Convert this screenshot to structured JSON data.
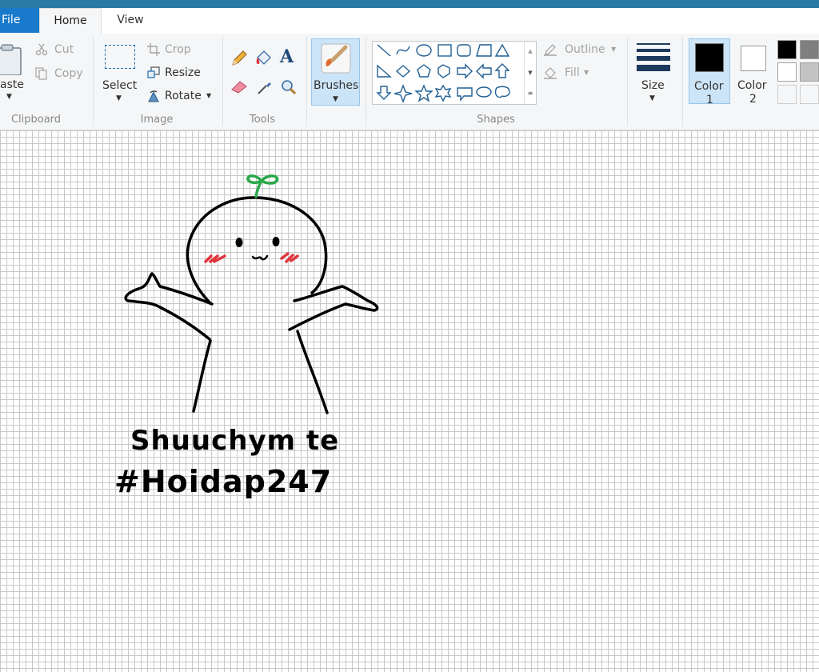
{
  "tabs": {
    "file": "File",
    "home": "Home",
    "view": "View"
  },
  "clipboard": {
    "paste": "aste",
    "cut": "Cut",
    "copy": "Copy",
    "label": "Clipboard"
  },
  "image": {
    "select": "Select",
    "crop": "Crop",
    "resize": "Resize",
    "rotate": "Rotate",
    "label": "Image"
  },
  "tools": {
    "label": "Tools"
  },
  "brushes": {
    "label": "Brushes"
  },
  "shapes": {
    "outline": "Outline",
    "fill": "Fill",
    "label": "Shapes"
  },
  "size": {
    "label": "Size"
  },
  "colors": {
    "color1_label": "Color",
    "color1_num": "1",
    "color2_label": "Color",
    "color2_num": "2",
    "color1_value": "#000000",
    "color2_value": "#ffffff"
  },
  "canvas": {
    "text_line1": "Shuuchym te",
    "text_line2": "#Hoidap247",
    "stroke_color": "#000000",
    "sprout_color": "#2aa84a",
    "blush_color": "#e0353d"
  }
}
